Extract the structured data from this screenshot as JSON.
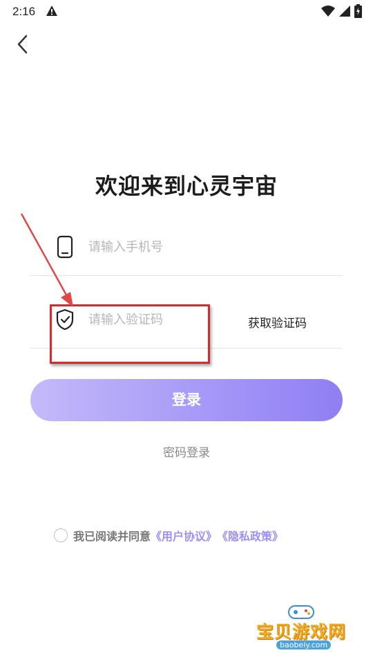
{
  "status_bar": {
    "time": "2:16"
  },
  "header": {
    "back": "back"
  },
  "title": "欢迎来到心灵宇宙",
  "phone": {
    "placeholder": "请输入手机号"
  },
  "code": {
    "placeholder": "请输入验证码",
    "get_code_label": "获取验证码"
  },
  "login_label": "登录",
  "password_login_label": "密码登录",
  "agreement": {
    "text": "我已阅读并同意",
    "user_agreement": "《用户协议》",
    "privacy_policy": "《隐私政策》"
  },
  "watermark": {
    "name": "宝贝游戏网",
    "url": "baobeiy.com"
  },
  "colors": {
    "accent": "#9d8ff5",
    "button_start": "#c4baf9",
    "button_end": "#8f7ff4",
    "highlight": "#d7282f"
  },
  "icons": [
    "alert-icon",
    "wifi-icon",
    "signal-icon",
    "battery-icon",
    "back-arrow-icon",
    "phone-icon",
    "shield-check-icon",
    "radio-icon",
    "gamepad-icon"
  ]
}
